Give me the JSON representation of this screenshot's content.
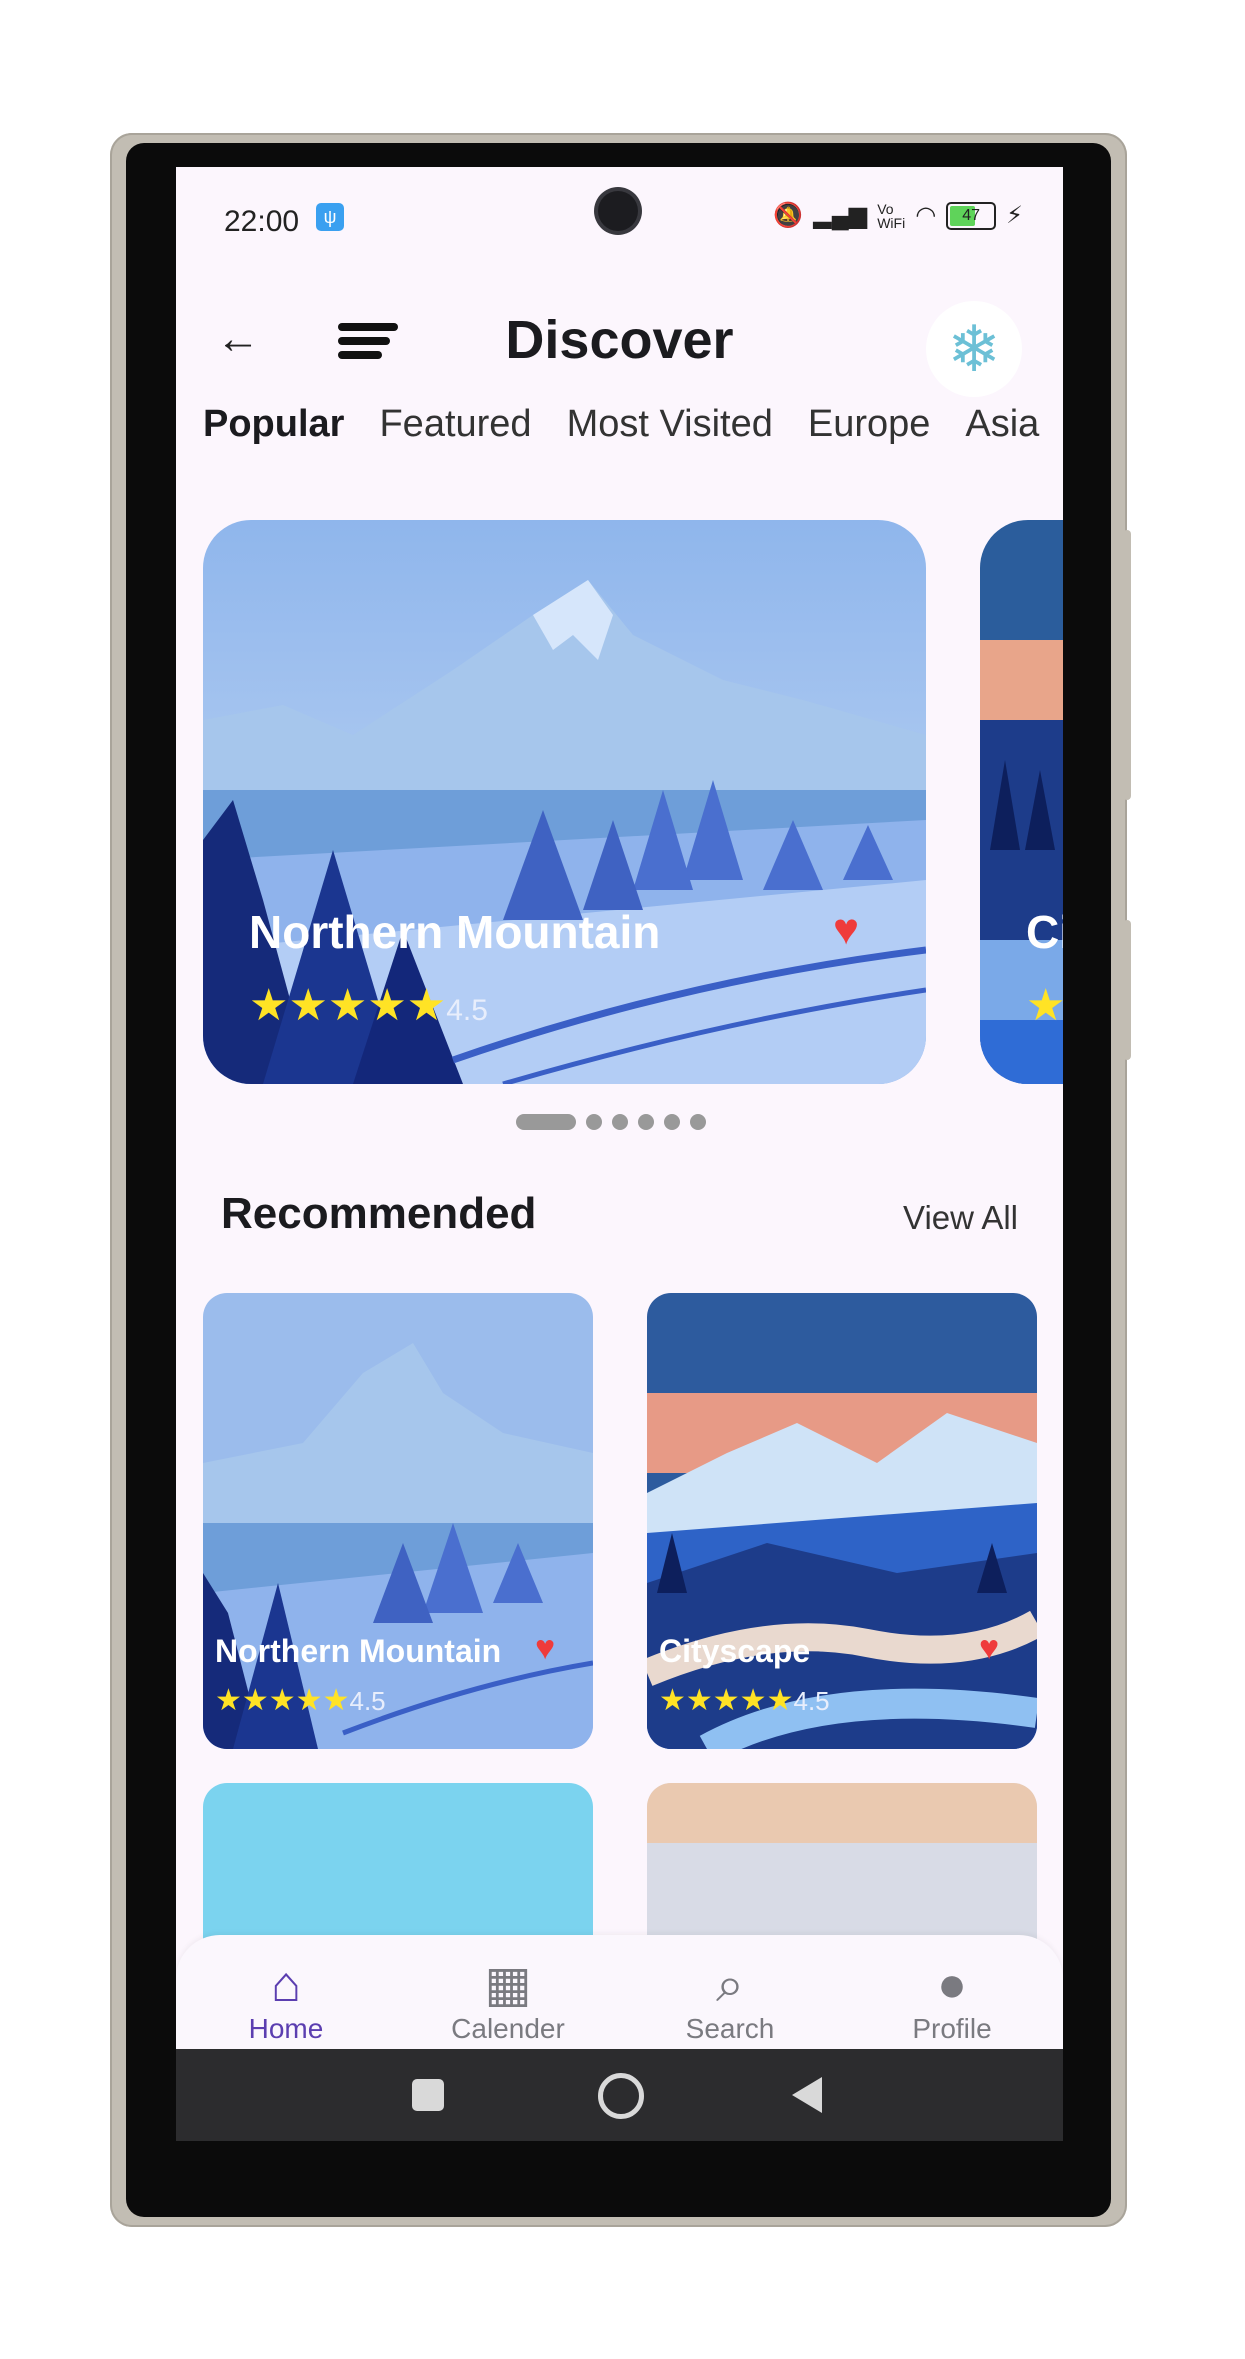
{
  "status_bar": {
    "time": "22:00",
    "battery": "47"
  },
  "header": {
    "title": "Discover"
  },
  "tabs": [
    "Popular",
    "Featured",
    "Most Visited",
    "Europe",
    "Asia"
  ],
  "carousel": {
    "main": {
      "title": "Northern Mountain",
      "stars": "★★★★★",
      "rating": "4.5"
    },
    "peek": {
      "title": "Ci",
      "stars": "★"
    }
  },
  "recommended": {
    "title": "Recommended",
    "view_all": "View All",
    "cards": [
      {
        "title": "Northern Mountain",
        "stars": "★★★★★",
        "rating": "4.5"
      },
      {
        "title": "Cityscape",
        "stars": "★★★★★",
        "rating": "4.5"
      }
    ]
  },
  "bottom_nav": [
    {
      "label": "Home",
      "icon": "home-icon"
    },
    {
      "label": "Calender",
      "icon": "calendar-icon"
    },
    {
      "label": "Search",
      "icon": "search-icon"
    },
    {
      "label": "Profile",
      "icon": "profile-icon"
    }
  ],
  "colors": {
    "accent": "#5b3eb0",
    "heart": "#ef3b3b",
    "star": "#ffe325",
    "background": "#fcf6fd"
  }
}
